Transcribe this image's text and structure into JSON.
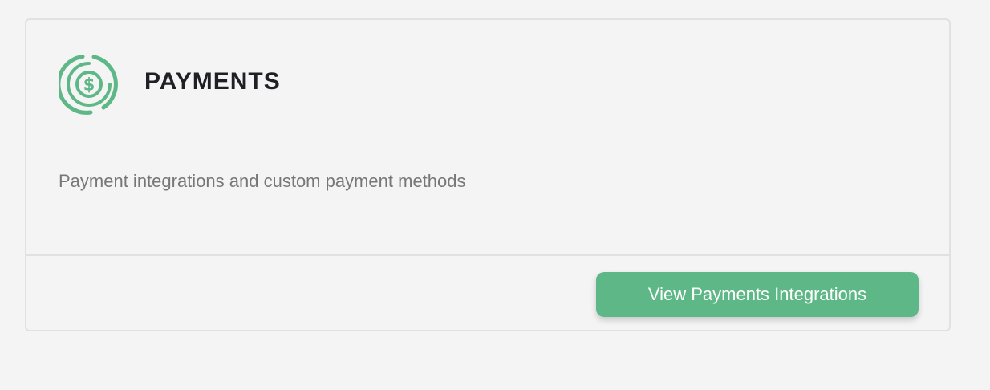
{
  "card": {
    "icon": "dollar-circle-icon",
    "title": "PAYMENTS",
    "description": "Payment integrations and custom payment methods",
    "button_label": "View Payments Integrations"
  },
  "colors": {
    "accent": "#5db786",
    "background": "#f4f4f4",
    "border": "#e1e1e1",
    "title": "#1f1f24",
    "description": "#777777"
  }
}
